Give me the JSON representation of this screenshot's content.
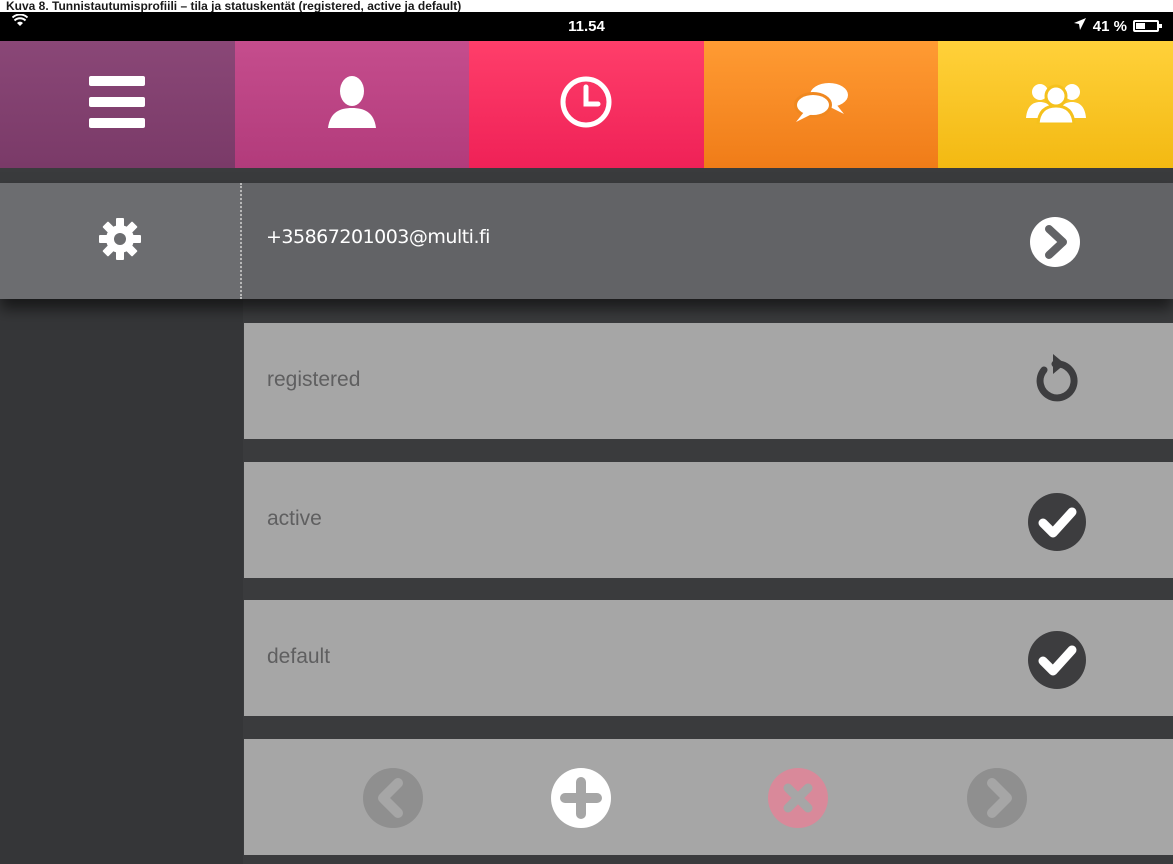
{
  "caption": "Kuva 8. Tunnistautumisprofiili – tila ja statuskentät (registered, active ja default)",
  "status_bar": {
    "time": "11.54",
    "battery": "41 %"
  },
  "tabs": [
    {
      "name": "menu",
      "icon": "hamburger-menu-icon",
      "color": "#8a4777"
    },
    {
      "name": "profile",
      "icon": "person-icon",
      "color": "#c54d8d"
    },
    {
      "name": "history",
      "icon": "clock-icon",
      "color": "#ff3e6a"
    },
    {
      "name": "chat",
      "icon": "chat-bubbles-icon",
      "color": "#ff9b33"
    },
    {
      "name": "groups",
      "icon": "group-icon",
      "color": "#ffd13a"
    }
  ],
  "account": {
    "address": "+35867201003@multi.fi",
    "settings_icon": "gear-icon",
    "next_icon": "chevron-right-icon"
  },
  "rows": [
    {
      "label": "registered",
      "icon": "refresh-icon"
    },
    {
      "label": "active",
      "icon": "check-icon"
    },
    {
      "label": "default",
      "icon": "check-icon"
    }
  ],
  "toolbar": {
    "icons": [
      "previous-icon",
      "add-icon",
      "delete-icon",
      "next-icon"
    ],
    "delete_color": "#e8637a"
  }
}
